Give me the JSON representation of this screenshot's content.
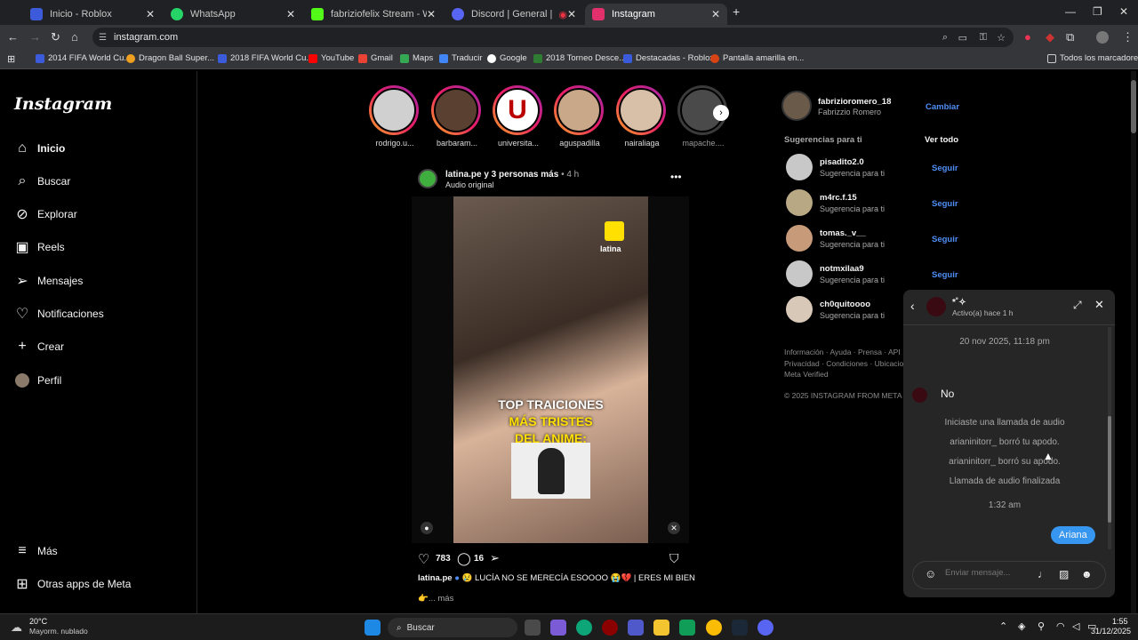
{
  "tabs": [
    {
      "title": "Inicio - Roblox",
      "color": "#3b5bdb"
    },
    {
      "title": "WhatsApp",
      "color": "#25d366"
    },
    {
      "title": "fabriziofelix Stream - Watch Liv",
      "color": "#53fc18"
    },
    {
      "title": "Discord | General | Xddd",
      "color": "#5865f2"
    },
    {
      "title": "Instagram",
      "color": "#e1306c"
    }
  ],
  "url": "instagram.com",
  "bookmarks": [
    "2014 FIFA World Cu...",
    "Dragon Ball Super...",
    "2018 FIFA World Cu...",
    "YouTube",
    "Gmail",
    "Maps",
    "Traducir",
    "Google",
    "2018 Torneo Desce...",
    "Destacadas - Roblox",
    "Pantalla amarilla en..."
  ],
  "all_bookmarks": "Todos los marcadores",
  "ig": {
    "logo": "Instagram",
    "nav": [
      "Inicio",
      "Buscar",
      "Explorar",
      "Reels",
      "Mensajes",
      "Notificaciones",
      "Crear",
      "Perfil"
    ],
    "more": "Más",
    "meta_apps": "Otras apps de Meta"
  },
  "stories": [
    "rodrigo.u...",
    "barbaram...",
    "universita...",
    "aguspadilla",
    "nairaliaga",
    "mapache...."
  ],
  "post": {
    "author_line": "latina.pe y 3 personas más",
    "time": "• 4 h",
    "audio": "Audio original",
    "brand": "latina",
    "overlay1": "TOP TRAICIONES",
    "overlay2": "MÁS TRISTES",
    "overlay3": "DEL ANIME:",
    "likes": "783",
    "comments": "16",
    "caption_user": "latina.pe",
    "caption": "😢 LUCÍA NO SE MERECÍA ESOOOO 😭💔 | ERES MI BIEN",
    "more": "👉... más"
  },
  "profile": {
    "user": "fabrizioromero_18",
    "name": "Fabrizzio Romero",
    "switch": "Cambiar"
  },
  "suggest_title": "Sugerencias para ti",
  "see_all": "Ver todo",
  "suggestions": [
    {
      "user": "pisadito2.0",
      "sub": "Sugerencia para ti",
      "action": "Seguir"
    },
    {
      "user": "m4rc.f.15",
      "sub": "Sugerencia para ti",
      "action": "Seguir"
    },
    {
      "user": "tomas._v__",
      "sub": "Sugerencia para ti",
      "action": "Seguir"
    },
    {
      "user": "notmxilaa9",
      "sub": "Sugerencia para ti",
      "action": "Seguir"
    },
    {
      "user": "ch0quitoooo",
      "sub": "Sugerencia para ti",
      "action": ""
    }
  ],
  "footer": {
    "line1": "Información · Ayuda · Prensa · API · E",
    "line2": "Privacidad · Condiciones · Ubicacio",
    "line3": "Meta Verified",
    "copyright": "© 2025 INSTAGRAM FROM META"
  },
  "chat": {
    "name": "*˚✧",
    "status": "Activo(a) hace 1 h",
    "date": "20 nov 2025, 11:18 pm",
    "incoming": "No",
    "sys1": "Iniciaste una llamada de audio",
    "sys2": "arianinitorr_ borró tu apodo.",
    "sys3": "arianinitorr_ borró su apodo.",
    "sys4": "Llamada de audio finalizada",
    "time2": "1:32 am",
    "outgoing": "Ariana",
    "placeholder": "Enviar mensaje..."
  },
  "taskbar": {
    "temp": "20°C",
    "weather": "Mayorm. nublado",
    "search": "Buscar",
    "time": "1:55",
    "date": "31/12/2025"
  }
}
